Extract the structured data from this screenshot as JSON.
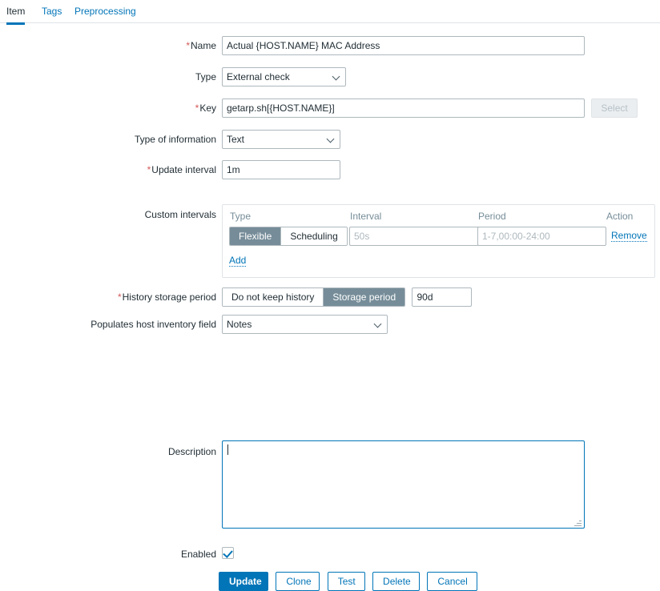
{
  "tabs": [
    {
      "label": "Item",
      "active": true
    },
    {
      "label": "Tags",
      "active": false
    },
    {
      "label": "Preprocessing",
      "active": false
    }
  ],
  "form": {
    "name": {
      "label": "Name",
      "required": true,
      "value": "Actual {HOST.NAME} MAC Address"
    },
    "type": {
      "label": "Type",
      "required": false,
      "value": "External check",
      "options": [
        "External check"
      ]
    },
    "key": {
      "label": "Key",
      "required": true,
      "value": "getarp.sh[{HOST.NAME}]",
      "select_button": "Select",
      "select_disabled": true
    },
    "type_of_information": {
      "label": "Type of information",
      "required": false,
      "value": "Text",
      "options": [
        "Text"
      ]
    },
    "update_interval": {
      "label": "Update interval",
      "required": true,
      "value": "1m"
    },
    "custom_intervals": {
      "label": "Custom intervals",
      "required": false,
      "columns": [
        "Type",
        "Interval",
        "Period",
        "Action"
      ],
      "rows": [
        {
          "type_options": [
            "Flexible",
            "Scheduling"
          ],
          "type_selected": "Flexible",
          "interval_value": "",
          "interval_placeholder": "50s",
          "period_value": "",
          "period_placeholder": "1-7,00:00-24:00",
          "action": "Remove"
        }
      ],
      "add_link": "Add"
    },
    "history_storage_period": {
      "label": "History storage period",
      "required": true,
      "options": [
        "Do not keep history",
        "Storage period"
      ],
      "selected": "Storage period",
      "value": "90d"
    },
    "host_inventory_field": {
      "label": "Populates host inventory field",
      "required": false,
      "value": "Notes",
      "options": [
        "Notes"
      ]
    },
    "description": {
      "label": "Description",
      "required": false,
      "value": "",
      "focused": true
    },
    "enabled": {
      "label": "Enabled",
      "checked": true
    }
  },
  "footer": {
    "buttons": [
      {
        "label": "Update",
        "primary": true
      },
      {
        "label": "Clone",
        "primary": false
      },
      {
        "label": "Test",
        "primary": false
      },
      {
        "label": "Delete",
        "primary": false
      },
      {
        "label": "Cancel",
        "primary": false
      }
    ]
  },
  "colors": {
    "accent": "#0275b8",
    "required": "#d45858",
    "segment_on": "#768d99",
    "border": "#aeb8bd",
    "placeholder": "#aeb8bd"
  }
}
